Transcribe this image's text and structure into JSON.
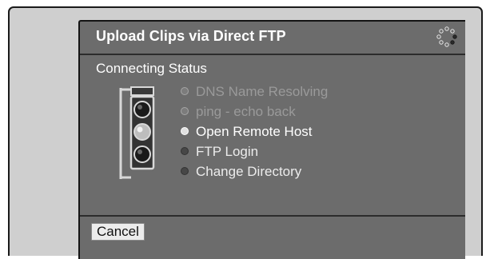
{
  "dialog": {
    "title": "Upload Clips via Direct FTP",
    "status_heading": "Connecting Status",
    "steps": [
      {
        "label": "DNS Name Resolving",
        "state": "done"
      },
      {
        "label": "ping - echo back",
        "state": "done"
      },
      {
        "label": "Open Remote Host",
        "state": "active"
      },
      {
        "label": "FTP Login",
        "state": "pending"
      },
      {
        "label": "Change Directory",
        "state": "pending"
      }
    ],
    "cancel_label": "Cancel"
  },
  "icons": {
    "spinner": "busy-spinner-icon",
    "traffic_light": "traffic-light-icon"
  },
  "colors": {
    "screen_background": "#cfcfcf",
    "dialog_background": "#6c6c6c",
    "text_active": "#ffffff",
    "text_done": "#9a9a9a"
  }
}
